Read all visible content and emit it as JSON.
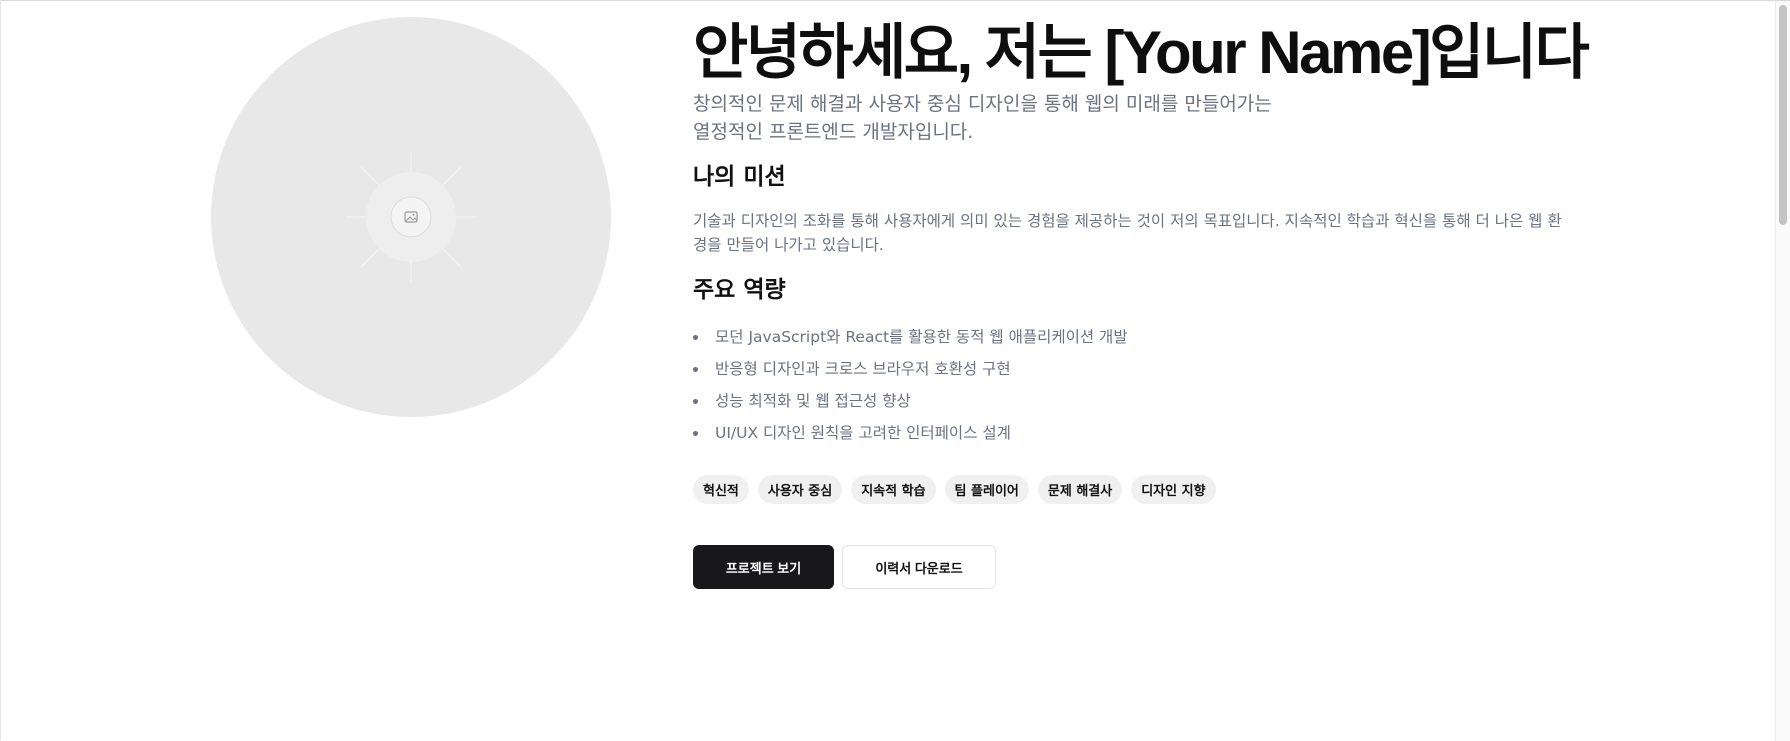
{
  "hero": {
    "title": "안녕하세요, 저는 [Your Name]입니다",
    "subtitle": "창의적인 문제 해결과 사용자 중심 디자인을 통해 웹의 미래를 만들어가는 열정적인 프론트엔드 개발자입니다."
  },
  "profile": {
    "image_icon": "image-placeholder-icon"
  },
  "mission": {
    "title": "나의 미션",
    "text": "기술과 디자인의 조화를 통해 사용자에게 의미 있는 경험을 제공하는 것이 저의 목표입니다. 지속적인 학습과 혁신을 통해 더 나은 웹 환경을 만들어 나가고 있습니다."
  },
  "skills": {
    "title": "주요 역량",
    "items": [
      "모던 JavaScript와 React를 활용한 동적 웹 애플리케이션 개발",
      "반응형 디자인과 크로스 브라우저 호환성 구현",
      "성능 최적화 및 웹 접근성 향상",
      "UI/UX 디자인 원칙을 고려한 인터페이스 설계"
    ]
  },
  "tags": [
    "혁신적",
    "사용자 중심",
    "지속적 학습",
    "팀 플레이어",
    "문제 해결사",
    "디자인 지향"
  ],
  "actions": {
    "primary_label": "프로젝트 보기",
    "secondary_label": "이력서 다운로드"
  },
  "colors": {
    "primary_button": "#18181b",
    "muted_text": "#6b7280",
    "tag_background": "#f0f0f0",
    "placeholder": "#e8e8e8"
  }
}
